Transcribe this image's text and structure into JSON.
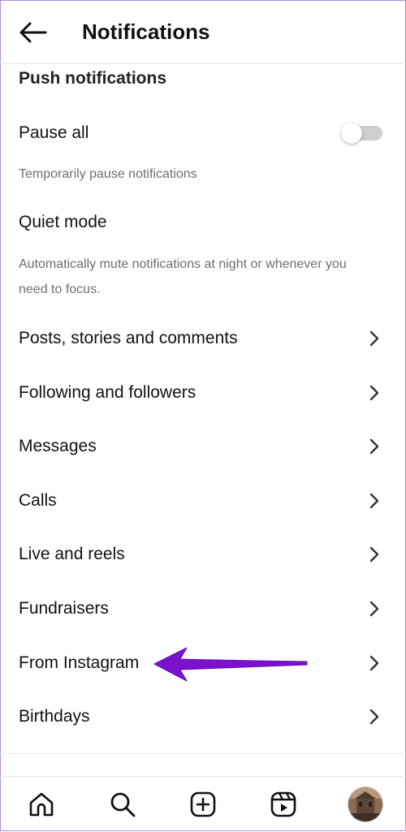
{
  "header": {
    "title": "Notifications",
    "back_icon": "arrow-left-icon"
  },
  "push": {
    "heading": "Push notifications",
    "pause_all": {
      "label": "Pause all",
      "enabled": false,
      "helper": "Temporarily pause notifications"
    },
    "quiet_mode": {
      "label": "Quiet mode",
      "helper_line1": "Automatically mute notifications at night or whenever you",
      "helper_line2": "need to focus."
    }
  },
  "items": [
    {
      "label": "Posts, stories and comments",
      "icon": "chevron-right-icon"
    },
    {
      "label": "Following and followers",
      "icon": "chevron-right-icon"
    },
    {
      "label": "Messages",
      "icon": "chevron-right-icon"
    },
    {
      "label": "Calls",
      "icon": "chevron-right-icon"
    },
    {
      "label": "Live and reels",
      "icon": "chevron-right-icon"
    },
    {
      "label": "Fundraisers",
      "icon": "chevron-right-icon"
    },
    {
      "label": "From Instagram",
      "icon": "chevron-right-icon"
    },
    {
      "label": "Birthdays",
      "icon": "chevron-right-icon"
    }
  ],
  "annotation": {
    "type": "arrow",
    "color": "#7a12cc",
    "points_to": "From Instagram"
  },
  "bottom_nav": [
    {
      "icon": "home-icon"
    },
    {
      "icon": "search-icon"
    },
    {
      "icon": "create-icon"
    },
    {
      "icon": "reels-icon"
    },
    {
      "icon": "profile-avatar"
    }
  ],
  "colors": {
    "text": "#111111",
    "secondary_text": "#6e6e6e",
    "toggle_track": "#cfcfcf",
    "annotation": "#7a12cc"
  }
}
